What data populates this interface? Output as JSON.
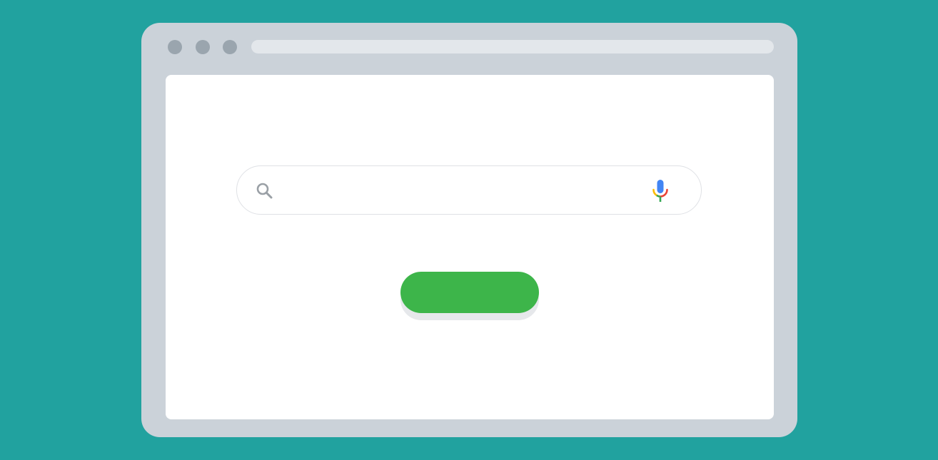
{
  "browser": {
    "address_bar": {
      "url": ""
    },
    "window_controls": [
      "close-dot",
      "minimize-dot",
      "maximize-dot"
    ]
  },
  "search": {
    "value": "",
    "placeholder": "",
    "icons": {
      "left": "search-icon",
      "right": "microphone-icon"
    }
  },
  "primary_button": {
    "label": ""
  },
  "colors": {
    "background": "#21a29f",
    "window_frame": "#cbd2d9",
    "window_dot": "#9aa5ae",
    "address_bar": "#e3e7eb",
    "viewport": "#ffffff",
    "search_border": "#dfe1e5",
    "button": "#3db54a",
    "button_shadow": "#e6e8eb",
    "mic_blue": "#4285f4",
    "mic_red": "#ea4335",
    "mic_yellow": "#fbbc05",
    "mic_green": "#34a853"
  }
}
